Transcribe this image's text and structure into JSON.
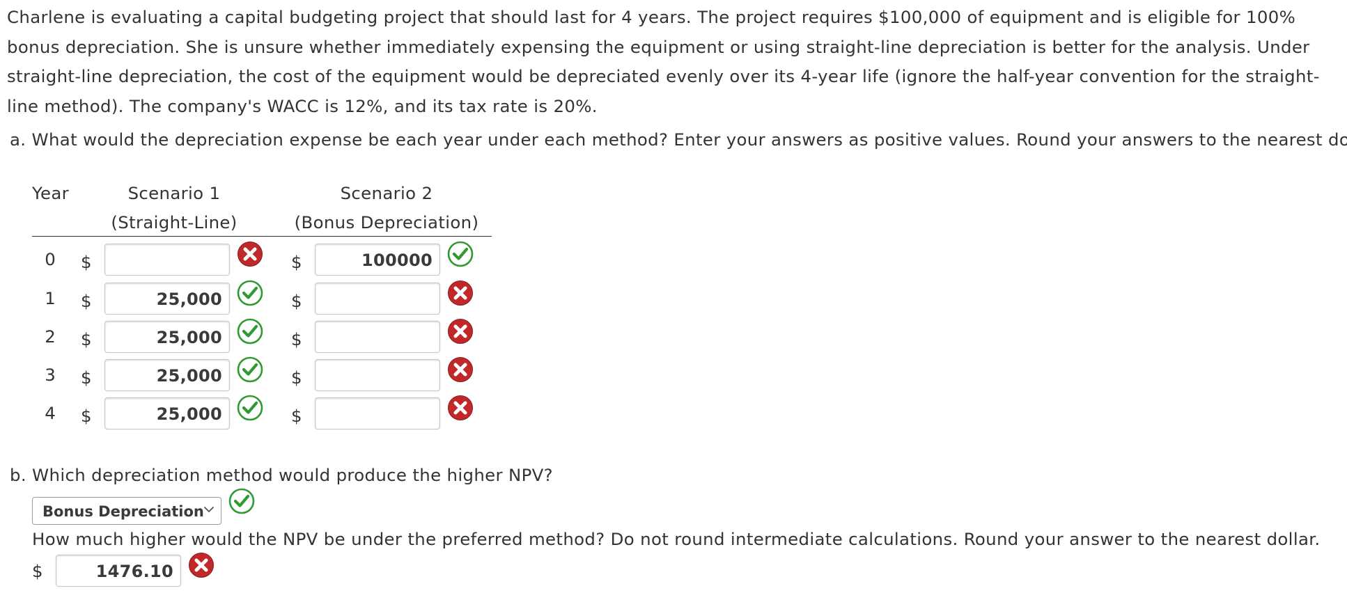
{
  "problem_text": "Charlene is evaluating a capital budgeting project that should last for 4 years. The project requires $100,000 of equipment and is eligible for 100% bonus depreciation. She is unsure whether immediately expensing the equipment or using straight-line depreciation is better for the analysis. Under straight-line depreciation, the cost of the equipment would be depreciated evenly over its 4-year life (ignore the half-year convention for the straight-line method). The company's WACC is 12%, and its tax rate is 20%.",
  "part_a": {
    "question": "a. What would the depreciation expense be each year under each method? Enter your answers as positive values. Round your answers to the nearest dollar.",
    "table": {
      "col_year": "Year",
      "col_s1_line1": "Scenario 1",
      "col_s1_line2": "(Straight-Line)",
      "col_s2_line1": "Scenario 2",
      "col_s2_line2": "(Bonus Depreciation)",
      "currency": "$",
      "rows": [
        {
          "year": "0",
          "s1_value": "",
          "s1_status": "incorrect",
          "s2_value": "100000",
          "s2_status": "correct"
        },
        {
          "year": "1",
          "s1_value": "25,000",
          "s1_status": "correct",
          "s2_value": "",
          "s2_status": "incorrect"
        },
        {
          "year": "2",
          "s1_value": "25,000",
          "s1_status": "correct",
          "s2_value": "",
          "s2_status": "incorrect"
        },
        {
          "year": "3",
          "s1_value": "25,000",
          "s1_status": "correct",
          "s2_value": "",
          "s2_status": "incorrect"
        },
        {
          "year": "4",
          "s1_value": "25,000",
          "s1_status": "correct",
          "s2_value": "",
          "s2_status": "incorrect"
        }
      ]
    }
  },
  "part_b": {
    "question": "b. Which depreciation method would produce the higher NPV?",
    "selected_method": "Bonus Depreciation",
    "select_status": "correct",
    "followup_question": "How much higher would the NPV be under the preferred method? Do not round intermediate calculations. Round your answer to the nearest dollar.",
    "currency": "$",
    "npv_difference_value": "1476.10",
    "npv_status": "incorrect"
  },
  "icons": {
    "correct": "check-circle-icon",
    "incorrect": "x-circle-icon",
    "dropdown": "chevron-down-icon"
  },
  "colors": {
    "text": "#333333",
    "correct_green": "#2f9a2f",
    "incorrect_red": "#c0282a"
  }
}
